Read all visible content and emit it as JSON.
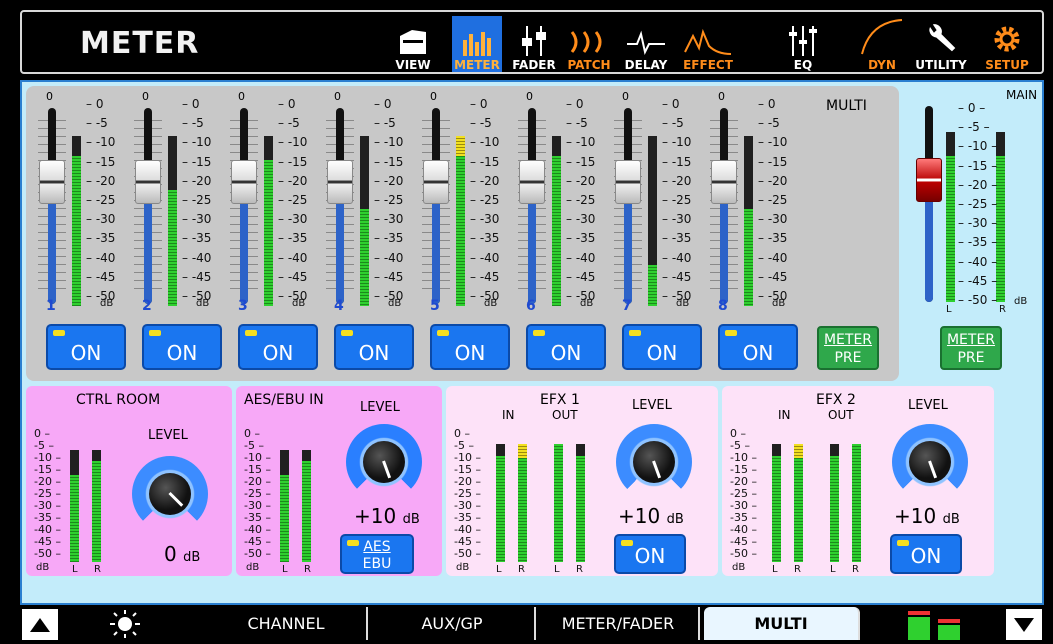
{
  "header": {
    "title": "METER",
    "nav": [
      {
        "id": "view",
        "label": "VIEW",
        "icon": "view-icon"
      },
      {
        "id": "meter",
        "label": "METER",
        "icon": "meter-icon",
        "active": true
      },
      {
        "id": "fader",
        "label": "FADER",
        "icon": "fader-icon"
      },
      {
        "id": "patch",
        "label": "PATCH",
        "icon": "patch-icon"
      },
      {
        "id": "delay",
        "label": "DELAY",
        "icon": "delay-icon"
      },
      {
        "id": "effect",
        "label": "EFFECT",
        "icon": "effect-icon"
      },
      {
        "id": "eq",
        "label": "EQ",
        "icon": "eq-icon"
      },
      {
        "id": "dyn",
        "label": "DYN",
        "icon": "dyn-icon"
      },
      {
        "id": "utility",
        "label": "UTILITY",
        "icon": "wrench-icon"
      },
      {
        "id": "setup",
        "label": "SETUP",
        "icon": "gear-icon"
      }
    ]
  },
  "multi": {
    "label": "MULTI",
    "zero": "0",
    "db": "dB",
    "scale": [
      "0",
      "-5",
      "-10",
      "-15",
      "-20",
      "-25",
      "-30",
      "-35",
      "-40",
      "-45",
      "-50"
    ],
    "channels": [
      {
        "num": "1",
        "on": "ON",
        "fader": 0.62,
        "meter": 0.88,
        "peak": 0
      },
      {
        "num": "2",
        "on": "ON",
        "fader": 0.62,
        "meter": 0.68,
        "peak": 0
      },
      {
        "num": "3",
        "on": "ON",
        "fader": 0.62,
        "meter": 0.86,
        "peak": 0
      },
      {
        "num": "4",
        "on": "ON",
        "fader": 0.62,
        "meter": 0.57,
        "peak": 0
      },
      {
        "num": "5",
        "on": "ON",
        "fader": 0.62,
        "meter": 1.0,
        "peak": 0.12
      },
      {
        "num": "6",
        "on": "ON",
        "fader": 0.62,
        "meter": 0.88,
        "peak": 0
      },
      {
        "num": "7",
        "on": "ON",
        "fader": 0.62,
        "meter": 0.24,
        "peak": 0
      },
      {
        "num": "8",
        "on": "ON",
        "fader": 0.62,
        "meter": 0.57,
        "peak": 0
      }
    ],
    "meter_pre": [
      "METER",
      "PRE"
    ]
  },
  "main_out": {
    "label": "MAIN",
    "zero": "0",
    "db": "dB",
    "l": "L",
    "r": "R",
    "meter_l": 0.86,
    "meter_r": 0.86,
    "fader": 0.62,
    "meter_pre": [
      "METER",
      "PRE"
    ],
    "scale": [
      "0",
      "-5",
      "-10",
      "-15",
      "-20",
      "-25",
      "-30",
      "-35",
      "-40",
      "-45",
      "-50"
    ]
  },
  "ctrl_room": {
    "title": "CTRL ROOM",
    "level_label": "LEVEL",
    "value": "0",
    "unit": "dB",
    "l": "L",
    "r": "R",
    "db": "dB",
    "meter_l": 0.78,
    "meter_r": 0.9
  },
  "aes": {
    "title": "AES/EBU IN",
    "level_label": "LEVEL",
    "value": "+10",
    "unit": "dB",
    "btn": [
      "AES",
      "EBU"
    ],
    "l": "L",
    "r": "R",
    "db": "dB",
    "meter_l": 0.78,
    "meter_r": 0.9
  },
  "efx1": {
    "title": "EFX 1",
    "in": "IN",
    "out": "OUT",
    "level_label": "LEVEL",
    "value": "+10",
    "unit": "dB",
    "on": "ON",
    "l1": "L",
    "r1": "R",
    "l2": "L",
    "r2": "R",
    "db": "dB"
  },
  "efx2": {
    "title": "EFX 2",
    "in": "IN",
    "out": "OUT",
    "level_label": "LEVEL",
    "value": "+10",
    "unit": "dB",
    "on": "ON",
    "l1": "L",
    "r1": "R",
    "l2": "L",
    "r2": "R",
    "db": "dB"
  },
  "small_scale": [
    "0",
    "-5",
    "-10",
    "-15",
    "-20",
    "-25",
    "-30",
    "-35",
    "-40",
    "-45",
    "-50"
  ],
  "tabs": {
    "items": [
      "CHANNEL",
      "AUX/GP",
      "METER/FADER",
      "MULTI"
    ],
    "selected": "MULTI"
  }
}
